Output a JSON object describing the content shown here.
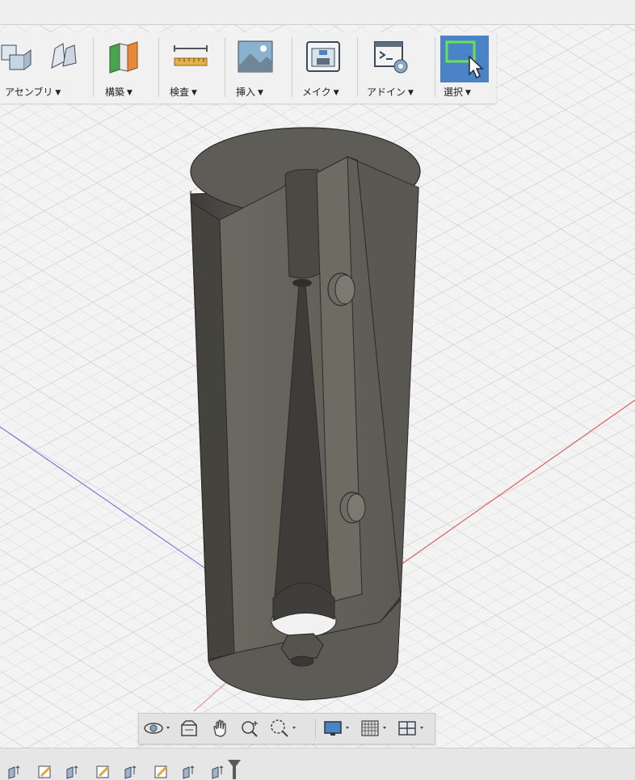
{
  "toolbar": {
    "groups": [
      {
        "id": "assembly",
        "label": "アセンブリ",
        "icon": "assembly-icon"
      },
      {
        "id": "construct",
        "label": "構築",
        "icon": "construct-plane-icon"
      },
      {
        "id": "inspect",
        "label": "検査",
        "icon": "measure-ruler-icon"
      },
      {
        "id": "insert",
        "label": "挿入",
        "icon": "insert-image-icon"
      },
      {
        "id": "make",
        "label": "メイク",
        "icon": "3d-print-icon"
      },
      {
        "id": "addins",
        "label": "アドイン",
        "icon": "script-addin-icon"
      },
      {
        "id": "select",
        "label": "選択",
        "icon": "select-cursor-icon"
      }
    ],
    "dropdown_glyph": "▼",
    "active_group": "select"
  },
  "colors": {
    "model_dark": "#4a4843",
    "model_mid": "#67645d",
    "model_light": "#8a877f",
    "grid": "#d6d6d6",
    "axis_red": "#e05555",
    "axis_blue": "#7777dd",
    "select_accent": "#4a84c6"
  },
  "nav_bar": {
    "icons": [
      "orbit-icon",
      "look-at-icon",
      "pan-hand-icon",
      "zoom-icon",
      "fit-zoom-icon",
      "display-settings-icon",
      "grid-settings-icon",
      "viewports-icon"
    ]
  },
  "timeline": {
    "icons": [
      "timeline-feature-icon",
      "timeline-sketch-icon",
      "timeline-feature-icon",
      "timeline-sketch-icon",
      "timeline-feature-icon",
      "timeline-sketch-icon",
      "timeline-feature-icon",
      "timeline-feature-icon",
      "timeline-marker-icon"
    ]
  }
}
